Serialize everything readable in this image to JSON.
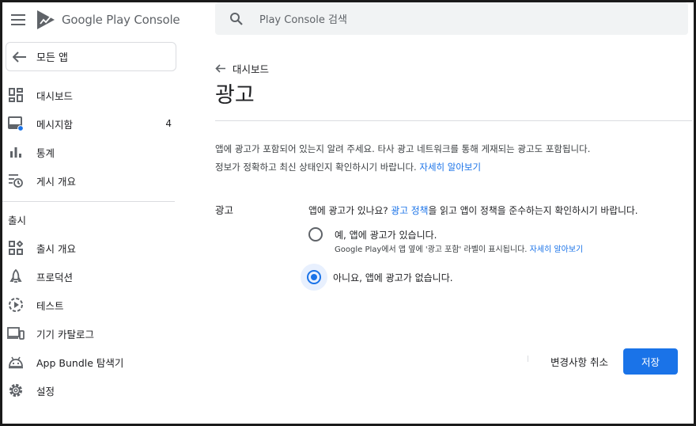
{
  "sidebar": {
    "brand": "Google Play Console",
    "all_apps": "모든 앱",
    "items": [
      {
        "label": "대시보드",
        "icon": "dashboard-icon"
      },
      {
        "label": "메시지함",
        "icon": "inbox-icon",
        "count": "4"
      },
      {
        "label": "통계",
        "icon": "bar-chart-icon"
      },
      {
        "label": "게시 개요",
        "icon": "publishing-overview-icon"
      }
    ],
    "section": "출시",
    "release_items": [
      {
        "label": "출시 개요",
        "icon": "release-overview-icon"
      },
      {
        "label": "프로덕션",
        "icon": "production-icon"
      },
      {
        "label": "테스트",
        "icon": "testing-icon"
      },
      {
        "label": "기기 카탈로그",
        "icon": "device-catalog-icon"
      },
      {
        "label": "App Bundle 탐색기",
        "icon": "android-icon"
      },
      {
        "label": "설정",
        "icon": "settings-icon"
      }
    ]
  },
  "search": {
    "placeholder": "Play Console 검색"
  },
  "breadcrumb": "대시보드",
  "page_title": "광고",
  "description": {
    "text1": "앱에 광고가 포함되어 있는지 알려 주세요. 타사 광고 네트워크를 통해 게재되는 광고도 포함됩니다.",
    "text2": "정보가 정확하고 최신 상태인지 확인하시기 바랍니다.",
    "link": "자세히 알아보기"
  },
  "ads_section": {
    "label": "광고",
    "question_pre": "앱에 광고가 있나요?",
    "question_link": "광고 정책",
    "question_post": "을 읽고 앱이 정책을 준수하는지 확인하시기 바랍니다.",
    "option_yes": "예, 앱에 광고가 있습니다.",
    "option_yes_sub": "Google Play에서 앱 옆에 '광고 포함' 라벨이 표시됩니다.",
    "option_yes_sub_link": "자세히 알아보기",
    "option_no": "아니요, 앱에 광고가 없습니다.",
    "selected": "no"
  },
  "actions": {
    "cancel": "변경사항 취소",
    "save": "저장"
  },
  "colors": {
    "accent": "#1a73e8",
    "selected_bg": "#e8f0fe",
    "notification_dot": "#1a73e8"
  }
}
